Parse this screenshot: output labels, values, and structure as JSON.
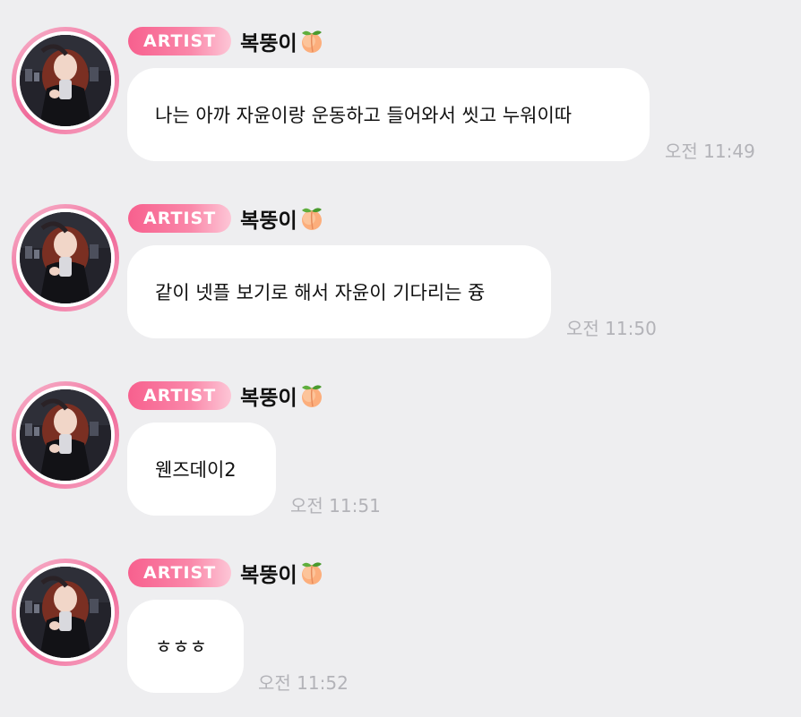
{
  "colors": {
    "background": "#eeeef0",
    "bubble": "#ffffff",
    "badge_start": "#f7608e",
    "badge_end": "#fdc6d6",
    "avatar_ring": "#f06a9a",
    "timestamp": "#b3b3b8"
  },
  "messages": [
    {
      "badge": "ARTIST",
      "sender": "복뚱이",
      "sender_icon": "peach-emoji",
      "text": "나는 아까 자윤이랑 운동하고 들어와서 씻고 누워이따",
      "time": "오전 11:49"
    },
    {
      "badge": "ARTIST",
      "sender": "복뚱이",
      "sender_icon": "peach-emoji",
      "text": "같이 넷플 보기로 해서 자윤이 기다리는 즁",
      "time": "오전 11:50"
    },
    {
      "badge": "ARTIST",
      "sender": "복뚱이",
      "sender_icon": "peach-emoji",
      "text": "웬즈데이2",
      "time": "오전 11:51"
    },
    {
      "badge": "ARTIST",
      "sender": "복뚱이",
      "sender_icon": "peach-emoji",
      "text": "ㅎㅎㅎ",
      "time": "오전 11:52"
    }
  ]
}
